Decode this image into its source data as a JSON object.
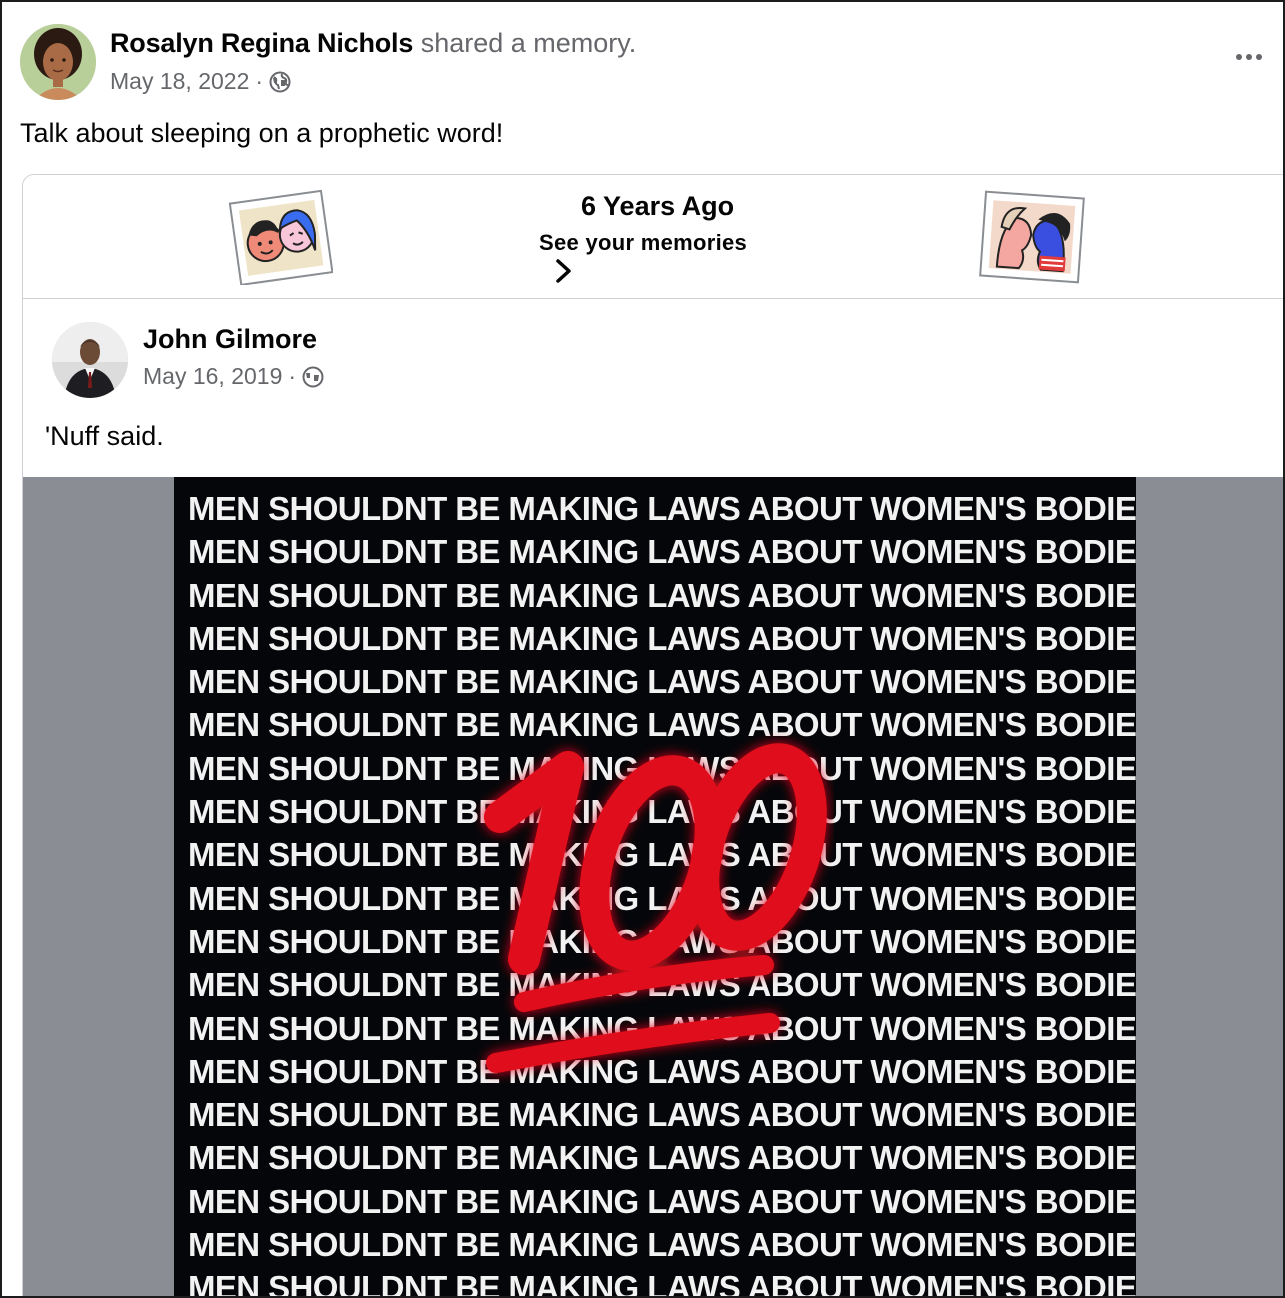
{
  "post": {
    "author": "Rosalyn Regina Nichols",
    "action": "shared a memory.",
    "date": "May 18, 2022",
    "separator": "·",
    "privacy_icon": "globe-icon",
    "more_icon": "more-options-icon",
    "text": "Talk about sleeping on a prophetic word!"
  },
  "memory": {
    "title": "6 Years Ago",
    "subtitle": "See your memories",
    "chevron_icon": "chevron-right-icon",
    "illustrations": [
      "friends-faces-illustration",
      "kissing-couple-illustration"
    ]
  },
  "original_post": {
    "author": "John Gilmore",
    "date": "May 16, 2019",
    "separator": "·",
    "privacy_icon": "globe-icon",
    "text": "'Nuff said."
  },
  "image": {
    "slogan": "MEN SHOULDNT BE MAKING LAWS ABOUT WOMEN'S BODIES",
    "line_count": 19,
    "emoji": "hundred-points-emoji",
    "emoji_color": "#e0101a",
    "background_color": "#05060a"
  }
}
